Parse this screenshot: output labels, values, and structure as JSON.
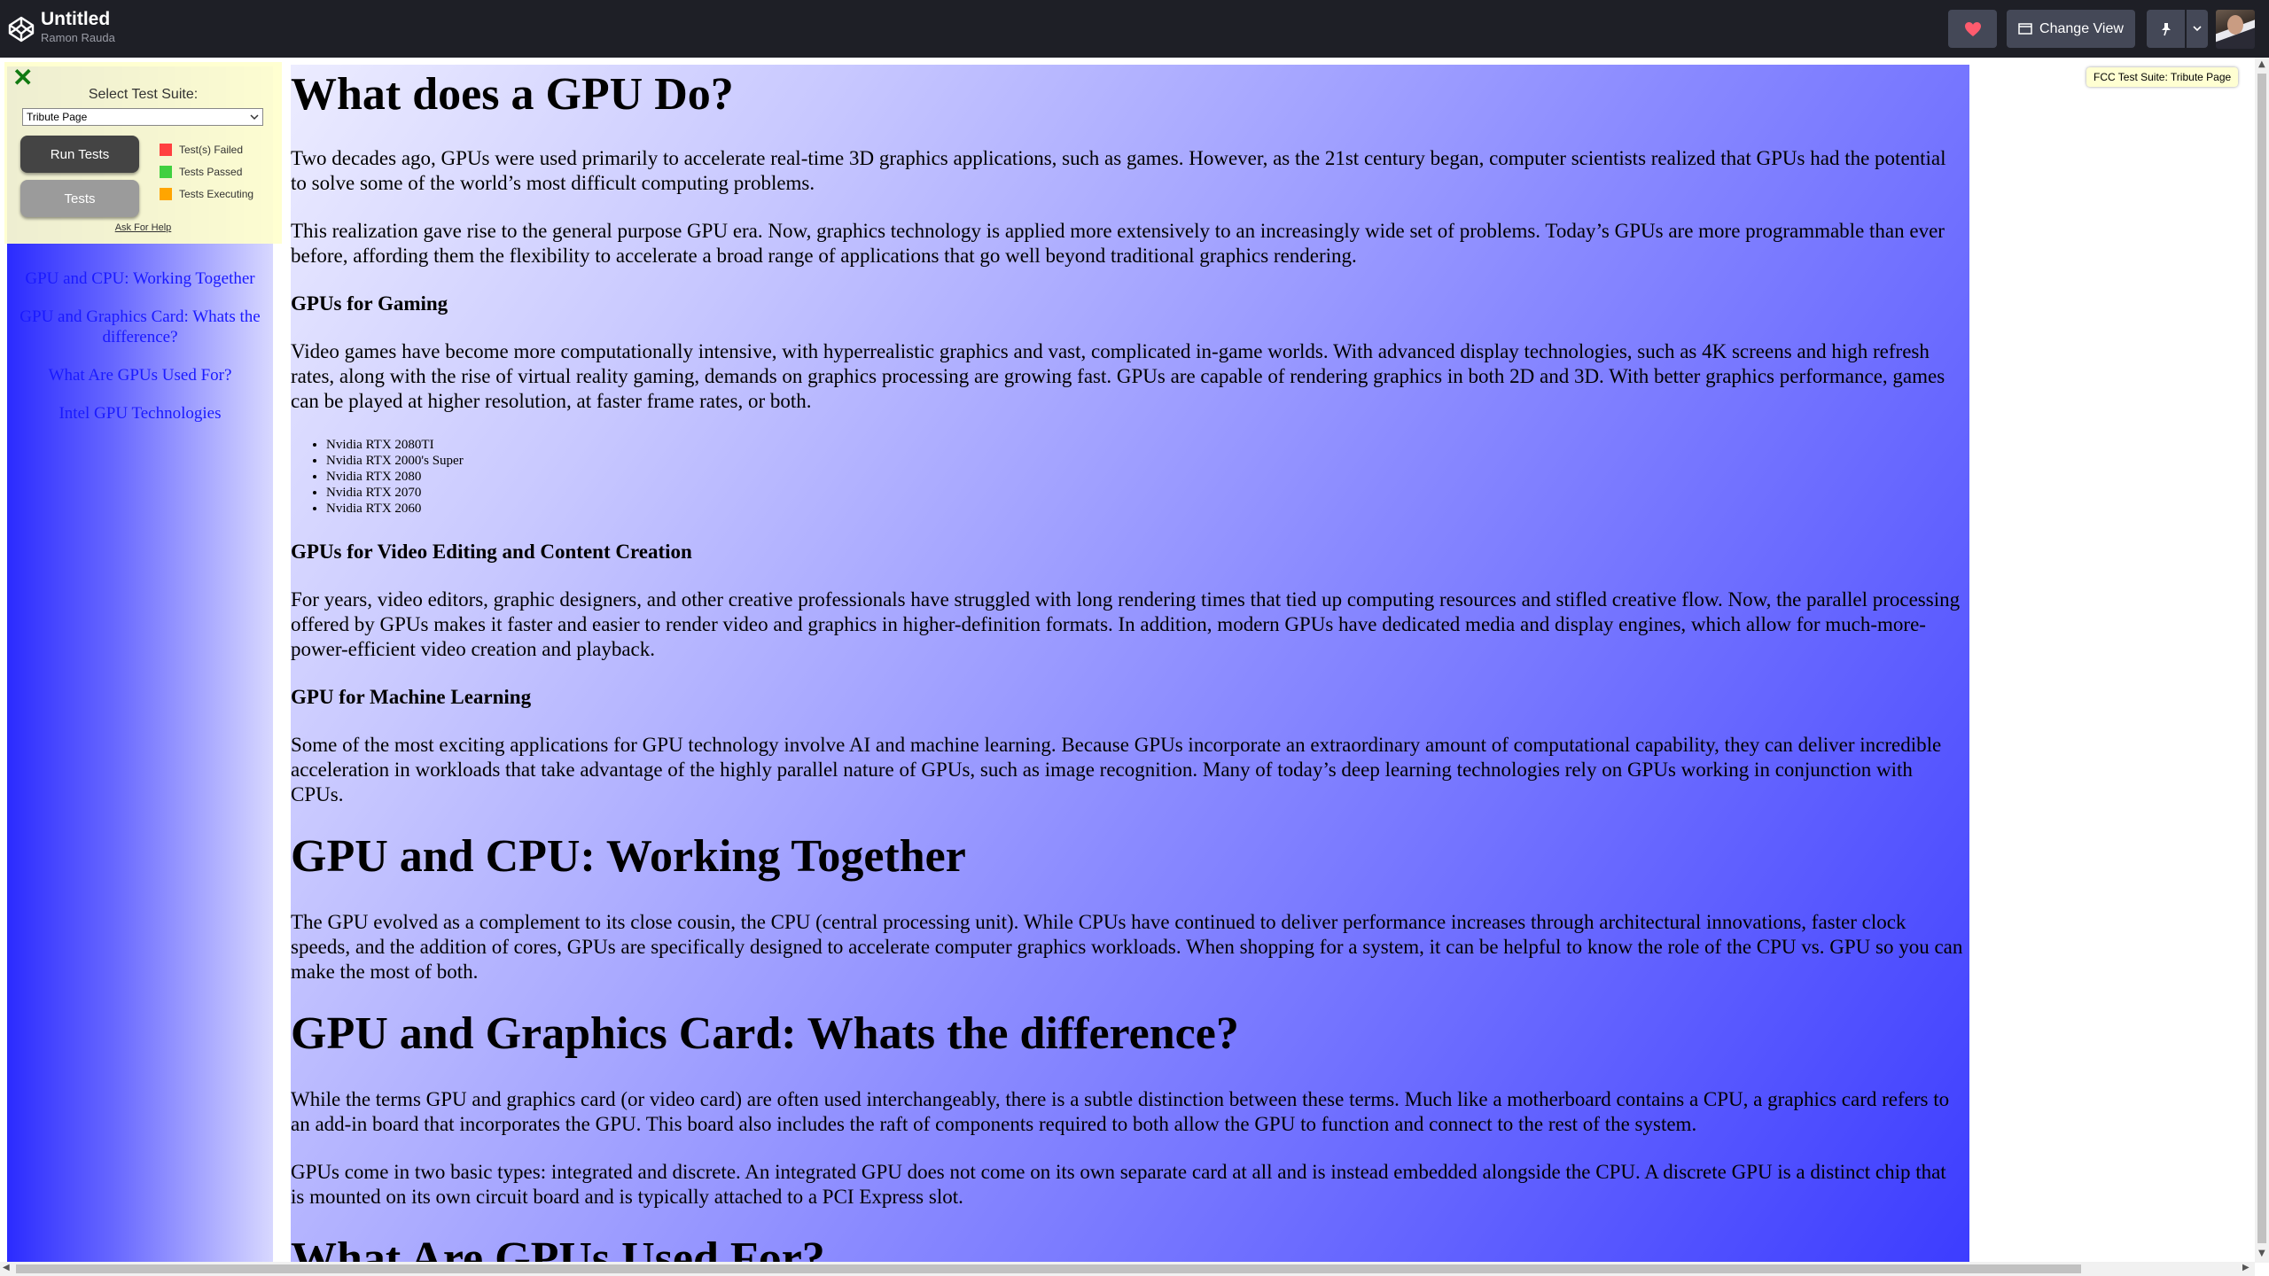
{
  "header": {
    "title": "Untitled",
    "author": "Ramon Rauda",
    "change_view_label": "Change View"
  },
  "icons": [
    "codepen-logo-icon",
    "heart-icon",
    "window-icon",
    "pin-icon",
    "chevron-down-icon",
    "avatar",
    "close-icon"
  ],
  "colors": {
    "heart": "#ff5b6e",
    "failed": "#ff4040",
    "passed": "#40d040",
    "executing": "#ffa500"
  },
  "fcc": {
    "select_label": "Select Test Suite:",
    "selected_suite": "Tribute Page",
    "run_tests": "Run Tests",
    "tests": "Tests",
    "legend_failed": "Test(s) Failed",
    "legend_passed": "Tests Passed",
    "legend_executing": "Tests Executing",
    "help": "Ask For Help",
    "tooltip": "FCC Test Suite: Tribute Page"
  },
  "nav": {
    "items": [
      "GPU and CPU: Working Together",
      "GPU and Graphics Card: Whats the difference?",
      "What Are GPUs Used For?",
      "Intel GPU Technologies"
    ]
  },
  "main": {
    "h1": "What does a GPU Do?",
    "p1": "Two decades ago, GPUs were used primarily to accelerate real-time 3D graphics applications, such as games. However, as the 21st century began, computer scientists realized that GPUs had the potential to solve some of the world’s most difficult computing problems.",
    "p2": "This realization gave rise to the general purpose GPU era. Now, graphics technology is applied more extensively to an increasingly wide set of problems. Today’s GPUs are more programmable than ever before, affording them the flexibility to accelerate a broad range of applications that go well beyond traditional graphics rendering.",
    "h3_gaming": "GPUs for Gaming",
    "p_gaming": "Video games have become more computationally intensive, with hyperrealistic graphics and vast, complicated in-game worlds. With advanced display technologies, such as 4K screens and high refresh rates, along with the rise of virtual reality gaming, demands on graphics processing are growing fast. GPUs are capable of rendering graphics in both 2D and 3D. With better graphics performance, games can be played at higher resolution, at faster frame rates, or both.",
    "gpu_list": [
      "Nvidia RTX 2080TI",
      "Nvidia RTX 2000's Super",
      "Nvidia RTX 2080",
      "Nvidia RTX 2070",
      "Nvidia RTX 2060"
    ],
    "h3_video": "GPUs for Video Editing and Content Creation",
    "p_video": "For years, video editors, graphic designers, and other creative professionals have struggled with long rendering times that tied up computing resources and stifled creative flow. Now, the parallel processing offered by GPUs makes it faster and easier to render video and graphics in higher-definition formats. In addition, modern GPUs have dedicated media and display engines, which allow for much-more-power-efficient video creation and playback.",
    "h3_ml": "GPU for Machine Learning",
    "p_ml": "Some of the most exciting applications for GPU technology involve AI and machine learning. Because GPUs incorporate an extraordinary amount of computational capability, they can deliver incredible acceleration in workloads that take advantage of the highly parallel nature of GPUs, such as image recognition. Many of today’s deep learning technologies rely on GPUs working in conjunction with CPUs.",
    "h2_cpu": "GPU and CPU: Working Together",
    "p_cpu": "The GPU evolved as a complement to its close cousin, the CPU (central processing unit). While CPUs have continued to deliver performance increases through architectural innovations, faster clock speeds, and the addition of cores, GPUs are specifically designed to accelerate computer graphics workloads. When shopping for a system, it can be helpful to know the role of the CPU vs. GPU so you can make the most of both.",
    "h2_card": "GPU and Graphics Card: Whats the difference?",
    "p_card1": "While the terms GPU and graphics card (or video card) are often used interchangeably, there is a subtle distinction between these terms. Much like a motherboard contains a CPU, a graphics card refers to an add-in board that incorporates the GPU. This board also includes the raft of components required to both allow the GPU to function and connect to the rest of the system.",
    "p_card2": "GPUs come in two basic types: integrated and discrete. An integrated GPU does not come on its own separate card at all and is instead embedded alongside the CPU. A discrete GPU is a distinct chip that is mounted on its own circuit board and is typically attached to a PCI Express slot.",
    "h2_used": "What Are GPUs Used For?"
  }
}
